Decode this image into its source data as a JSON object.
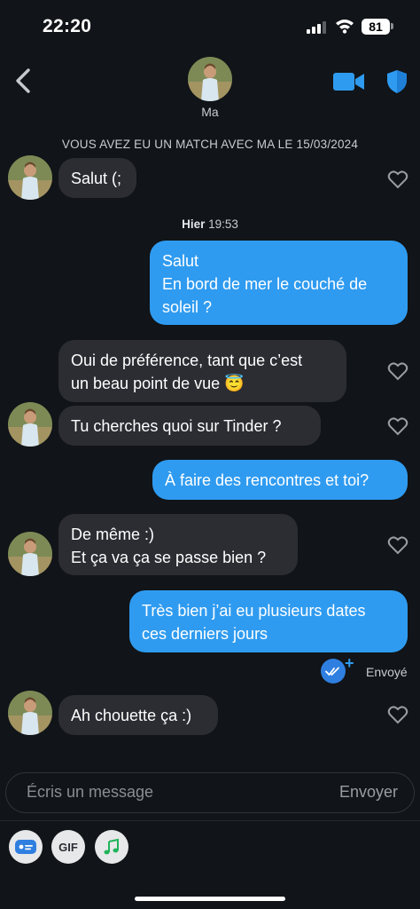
{
  "status_bar": {
    "time": "22:20",
    "battery": "81"
  },
  "header": {
    "contact_name": "Ma"
  },
  "match_note": "VOUS AVEZ EU UN MATCH AVEC MA LE 15/03/2024",
  "day_note": {
    "day": "Hier",
    "time": "19:53"
  },
  "messages": [
    {
      "from": "them",
      "text": "Salut (;"
    },
    {
      "from": "me",
      "text": "Salut\nEn bord de mer le couché de\nsoleil ?"
    },
    {
      "from": "them",
      "text": "Oui de préférence, tant que c’est\nun beau point de vue 😇"
    },
    {
      "from": "them",
      "text": "Tu cherches quoi sur Tinder ?"
    },
    {
      "from": "me",
      "text": "À faire des rencontres et toi?"
    },
    {
      "from": "them",
      "text": "De même :)\nEt ça va ça se passe bien ?"
    },
    {
      "from": "me",
      "text": "Très bien j’ai eu plusieurs dates\nces derniers jours"
    },
    {
      "from": "them",
      "text": "Ah chouette ça :)"
    }
  ],
  "sent_status": "Envoyé",
  "composer": {
    "placeholder": "Écris un message",
    "send_label": "Envoyer"
  },
  "bottom_buttons": {
    "gif_label": "GIF"
  },
  "colors": {
    "outgoing_bubble": "#2f9bf0",
    "incoming_bubble": "#2b2d33",
    "background": "#111418",
    "accent": "#2f9bf0"
  }
}
